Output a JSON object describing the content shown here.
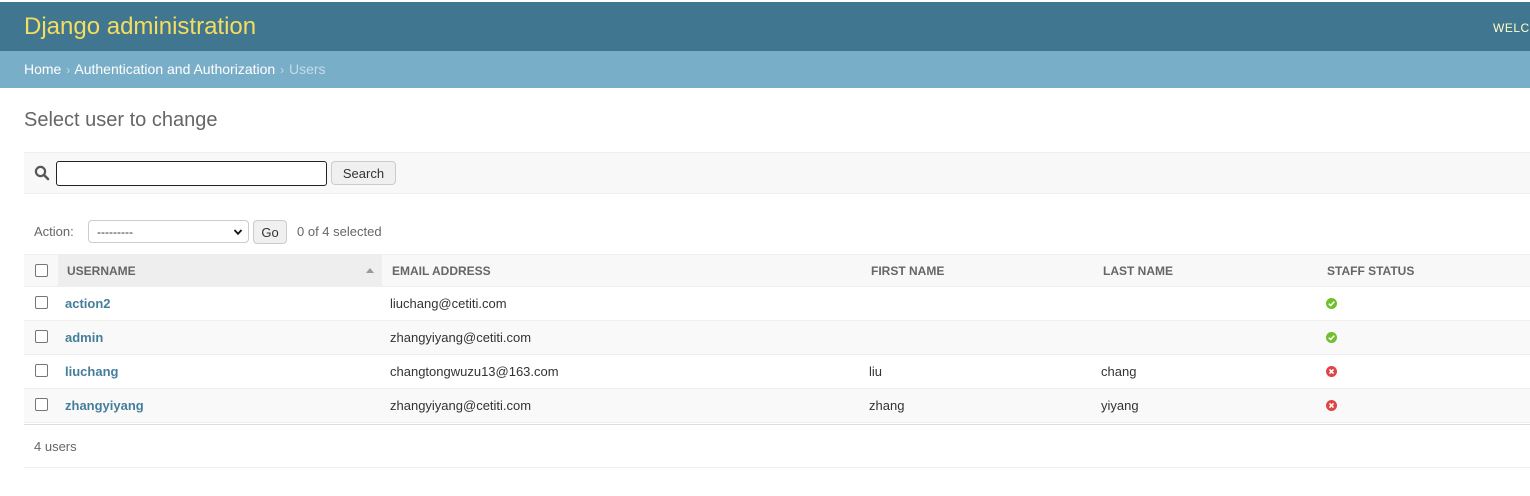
{
  "header": {
    "site_title": "Django administration",
    "welcome": "WELCOME"
  },
  "breadcrumbs": {
    "home": "Home",
    "app": "Authentication and Authorization",
    "current": "Users",
    "separator": "›"
  },
  "page": {
    "title": "Select user to change"
  },
  "search": {
    "value": "",
    "placeholder": "",
    "button_label": "Search"
  },
  "actions": {
    "label": "Action:",
    "selected_option": "---------",
    "go_label": "Go",
    "selection_counter": "0 of 4 selected"
  },
  "table": {
    "columns": [
      "Username",
      "Email address",
      "First name",
      "Last name",
      "Staff status"
    ],
    "sorted_column": "Username",
    "rows": [
      {
        "username": "action2",
        "email": "liuchang@cetiti.com",
        "first_name": "",
        "last_name": "",
        "staff_status": "yes"
      },
      {
        "username": "admin",
        "email": "zhangyiyang@cetiti.com",
        "first_name": "",
        "last_name": "",
        "staff_status": "yes"
      },
      {
        "username": "liuchang",
        "email": "changtongwuzu13@163.com",
        "first_name": "liu",
        "last_name": "chang",
        "staff_status": "no"
      },
      {
        "username": "zhangyiyang",
        "email": "zhangyiyang@cetiti.com",
        "first_name": "zhang",
        "last_name": "yiyang",
        "staff_status": "no"
      }
    ]
  },
  "paginator": {
    "count_text": "4 users"
  },
  "icons": {
    "search": "search-icon",
    "staff_yes": "check-circle-icon",
    "staff_no": "x-circle-icon",
    "sort_asc": "sort-ascending-icon",
    "select_chevron": "chevron-down-icon"
  },
  "colors": {
    "header_bg": "#417690",
    "site_title": "#f5dd5d",
    "breadcrumbs_bg": "#79aec8",
    "link": "#447e9b",
    "yes": "#70bf2b",
    "no": "#dd4646"
  }
}
